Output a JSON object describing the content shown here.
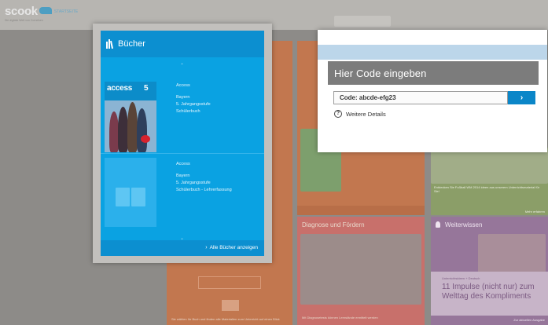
{
  "header": {
    "logo_text": "scook",
    "logo_badge": "STARTSEITE",
    "logo_tagline": "Die digitale Welt von Cornelsen"
  },
  "background_tiles": {
    "right_tile_text_1": "Entdecken Sie Fußball WM 2014 ideen aus unserem Unterrichtsmaterial für Sie!",
    "right_tile_link_1": "Mehr erfahren",
    "left_tile_text": "Sie wählen Ihr Buch und finden alle Materialien zum Unterricht auf einen Blick",
    "diagnose_title": "Diagnose und Fördern",
    "diagnose_text": "Mit Diagnosetests können Lernstände ermittelt werden",
    "weiterwissen_title": "Weiterwissen",
    "weiterwissen_small": "Unterrichtsideen + Deutsch",
    "weiterwissen_headline_1": "11 Impulse (nicht nur) zum",
    "weiterwissen_headline_2": "Welttag des Kompliments",
    "weiterwissen_link": "Zur aktuellen Ausgabe"
  },
  "books_panel": {
    "title": "Bücher",
    "books": [
      {
        "series": "Access",
        "cover_title": "access",
        "cover_number": "5",
        "lines": [
          "Bayern",
          "5. Jahrgangsstufe",
          "Schülerbuch"
        ]
      },
      {
        "series": "Access",
        "lines": [
          "Bayern",
          "5. Jahrgangsstufe",
          "Schülerbuch - Lehrerfassung"
        ]
      }
    ],
    "all_books_label": "Alle Bücher anzeigen",
    "chevron_up": "⌃",
    "chevron_down": "⌄",
    "chevron_right": "›"
  },
  "code_panel": {
    "title": "Hier Code eingeben",
    "input_value": "Code: abcde-efg23",
    "submit_label": "›",
    "details_icon": "?",
    "details_label": "Weitere Details"
  },
  "colors": {
    "books_blue": "#0aa2e2",
    "books_header_blue": "#0c8fd0",
    "code_title_gray": "#7c7c7c",
    "submit_blue": "#0b86c8",
    "overlay_background": "#8d8b88"
  },
  "icons": {
    "books": "books-icon",
    "info": "info-icon",
    "arrow_right": "chevron-right-icon"
  }
}
